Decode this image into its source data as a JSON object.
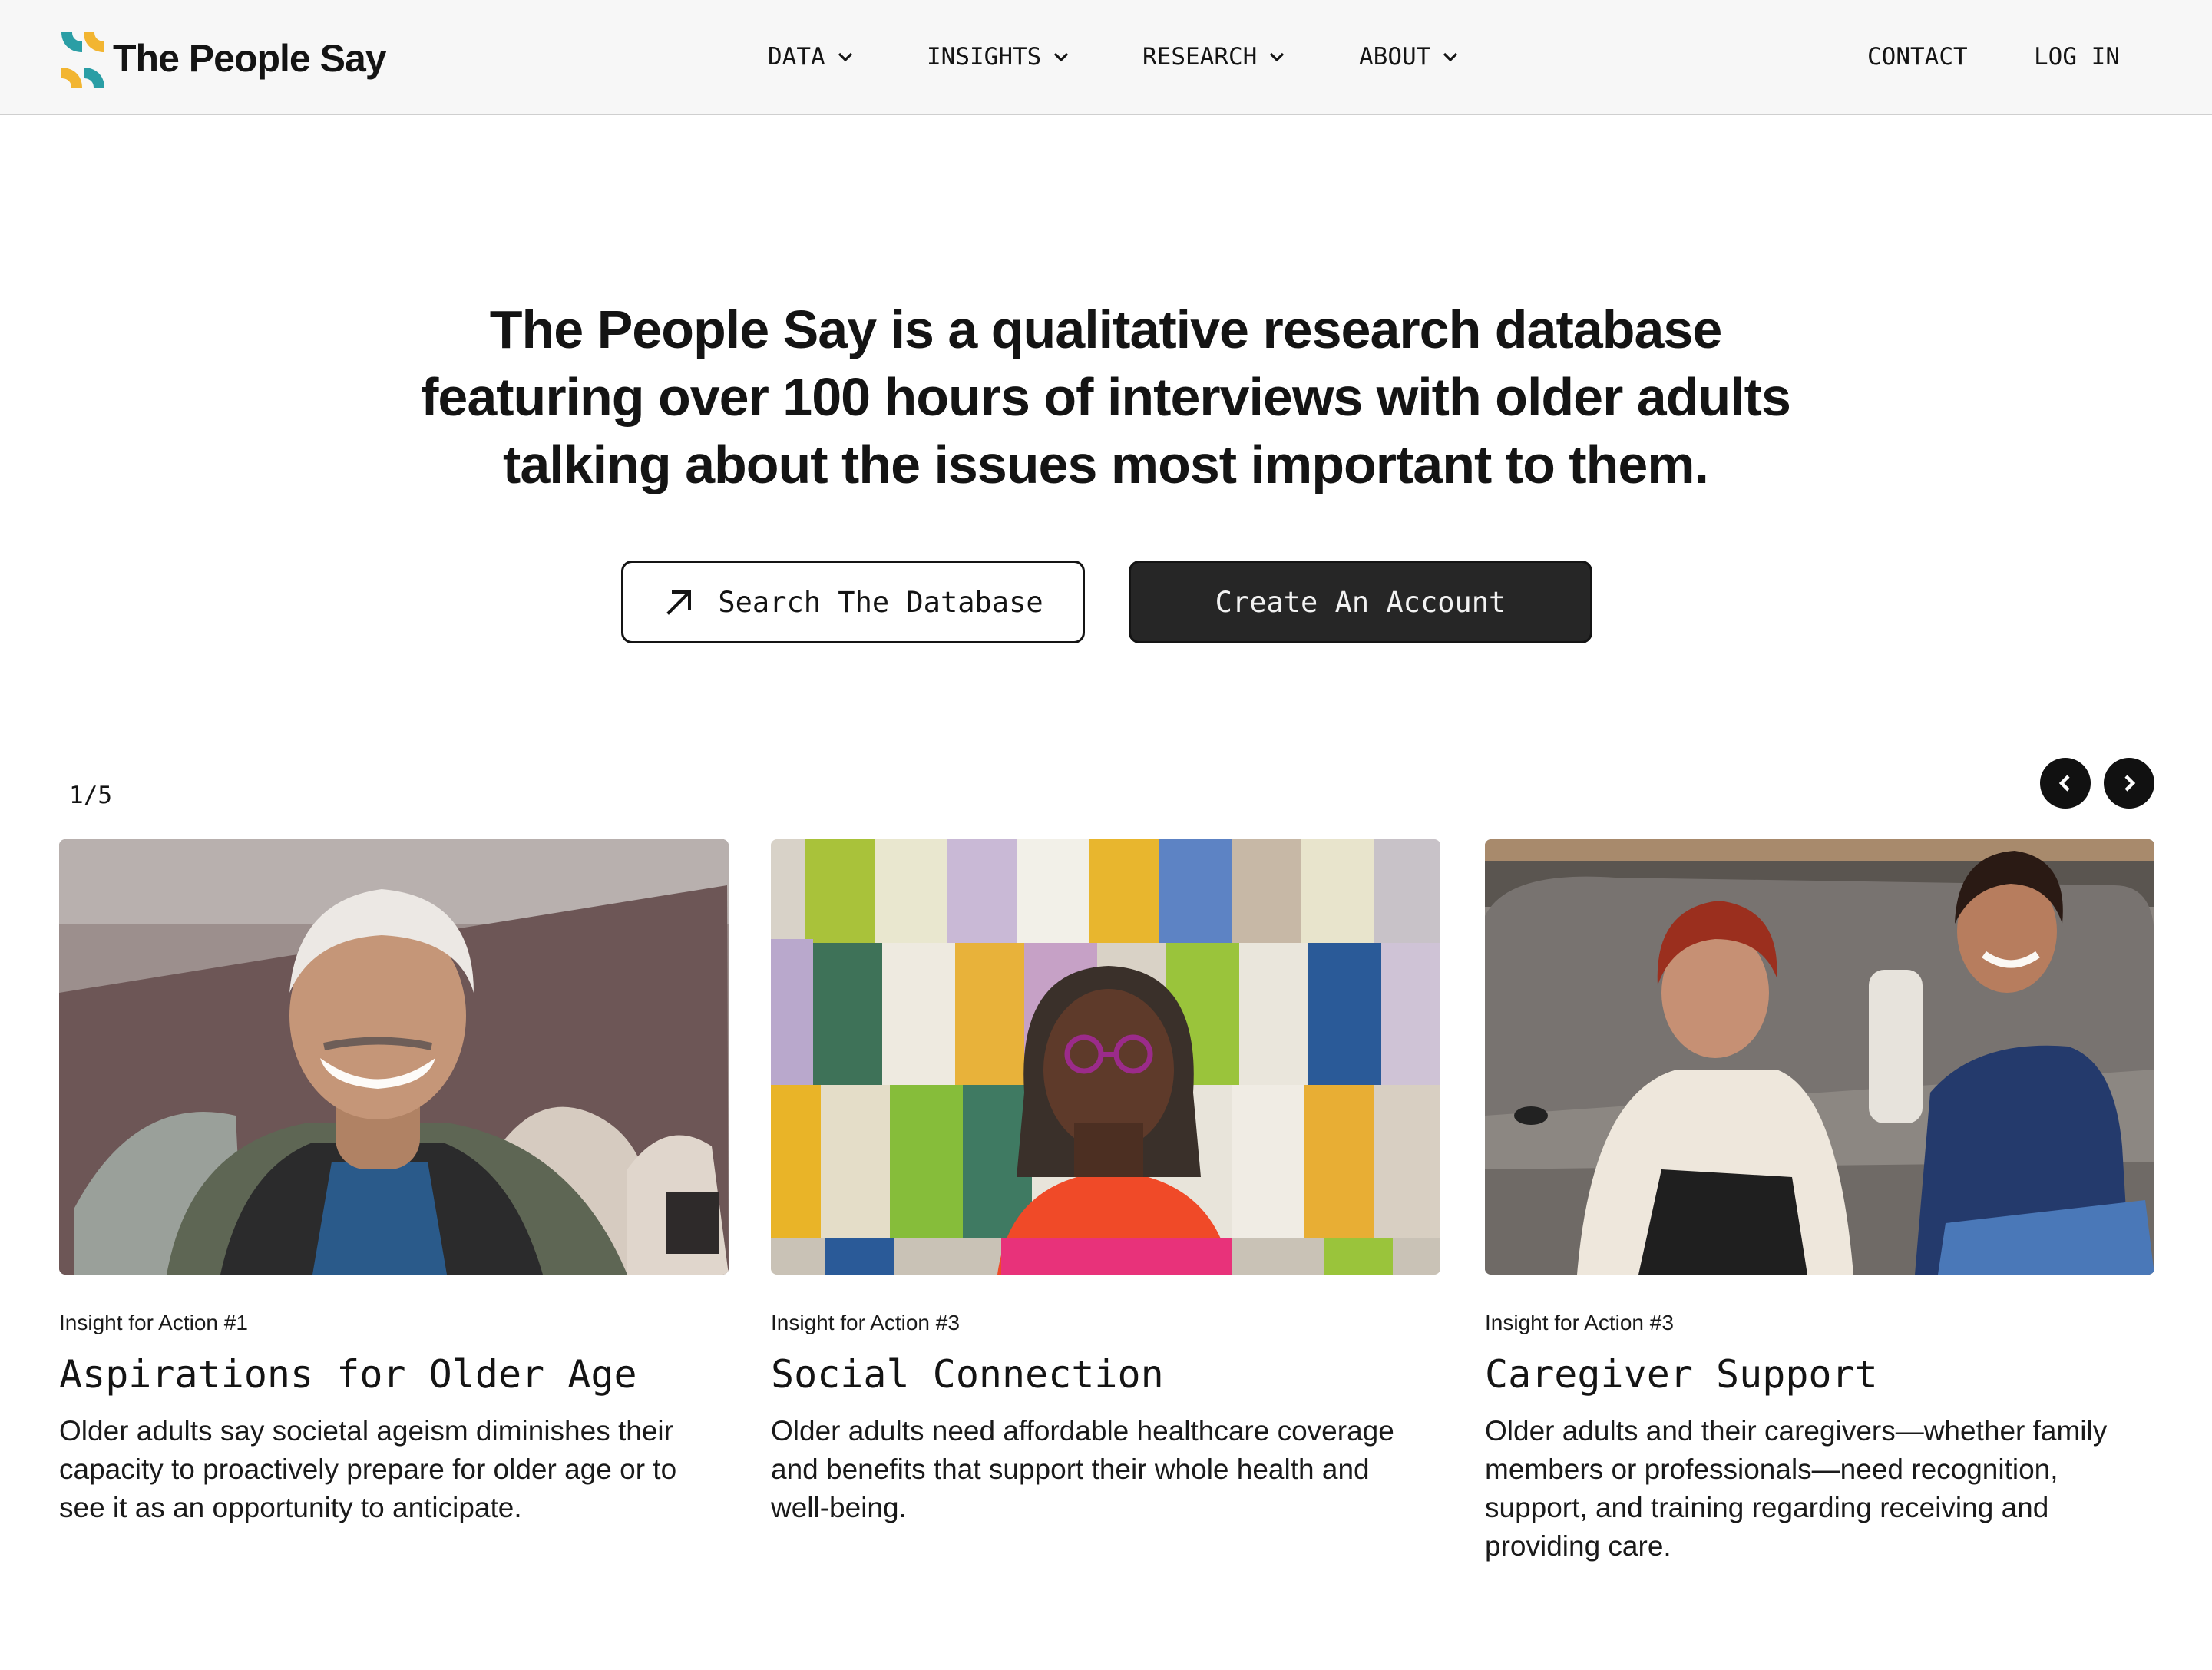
{
  "brand": {
    "name": "The People Say",
    "logo_icon": "brand-mark-icon",
    "colors": [
      "#2a9ea5",
      "#f2b531"
    ]
  },
  "nav": {
    "items": [
      {
        "label": "DATA",
        "icon": "chevron-down-icon"
      },
      {
        "label": "INSIGHTS",
        "icon": "chevron-down-icon"
      },
      {
        "label": "RESEARCH",
        "icon": "chevron-down-icon"
      },
      {
        "label": "ABOUT",
        "icon": "chevron-down-icon"
      }
    ],
    "contact": "CONTACT",
    "login": "LOG IN"
  },
  "hero": {
    "lines": [
      "The People Say is a qualitative research database",
      "featuring over 100 hours of interviews with older adults",
      "talking about the issues most important to them."
    ],
    "search_button": "Search The Database",
    "search_icon": "arrow-up-right-icon",
    "account_button": "Create An Account"
  },
  "carousel": {
    "counter": "1/5",
    "prev_icon": "chevron-left-icon",
    "next_icon": "chevron-right-icon",
    "cards": [
      {
        "eyebrow": "Insight for Action #1",
        "title": "Aspirations for Older Age",
        "body": "Older adults say societal ageism diminishes  their capacity to proactively prepare for older age or to see it as an opportunity to anticipate."
      },
      {
        "eyebrow": "Insight for Action #3",
        "title": "Social Connection",
        "body": "Older adults need affordable healthcare coverage and benefits that support their whole health and well-being."
      },
      {
        "eyebrow": "Insight for Action #3",
        "title": "Caregiver Support",
        "body": "Older adults and their caregivers—whether family members or professionals—need recognition, support, and training regarding receiving and providing care."
      }
    ]
  }
}
